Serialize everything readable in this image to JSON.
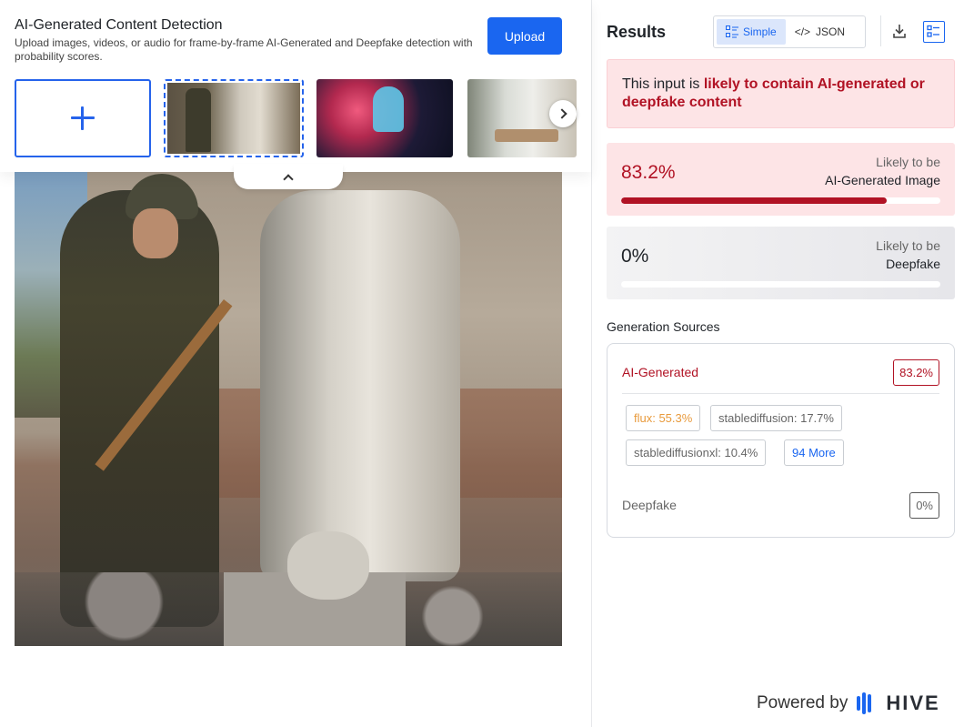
{
  "header": {
    "title": "AI-Generated Content Detection",
    "subtitle": "Upload images, videos, or audio for frame-by-frame AI-Generated and Deepfake detection with probability scores.",
    "upload_label": "Upload"
  },
  "thumbnails": {
    "add_icon": "plus-icon",
    "next_icon": "chevron-right-icon",
    "collapse_icon": "chevron-up-icon"
  },
  "results": {
    "title": "Results",
    "toggle": {
      "simple_label": "Simple",
      "json_label": "JSON",
      "json_prefix": "</>"
    },
    "verdict": {
      "prefix": "This input is ",
      "highlight": "likely to contain AI-generated or deepfake content"
    },
    "ai_score": {
      "value": "83.2%",
      "fraction": 0.832,
      "caption_top": "Likely to be",
      "caption_bottom": "AI-Generated Image"
    },
    "deepfake_score": {
      "value": "0%",
      "fraction": 0,
      "caption_top": "Likely to be",
      "caption_bottom": "Deepfake"
    }
  },
  "generation": {
    "title": "Generation Sources",
    "ai_label": "AI-Generated",
    "ai_value": "83.2%",
    "sources": [
      {
        "label": "flux: 55.3%"
      },
      {
        "label": "stablediffusion: 17.7%"
      },
      {
        "label": "stablediffusionxl: 10.4%"
      }
    ],
    "more_label": "94 More",
    "deepfake_label": "Deepfake",
    "deepfake_value": "0%"
  },
  "footer": {
    "powered_by": "Powered by",
    "brand": "HIVE"
  },
  "colors": {
    "accent": "#1a66f0",
    "danger": "#b11224",
    "danger_bg": "#fde4e6"
  }
}
